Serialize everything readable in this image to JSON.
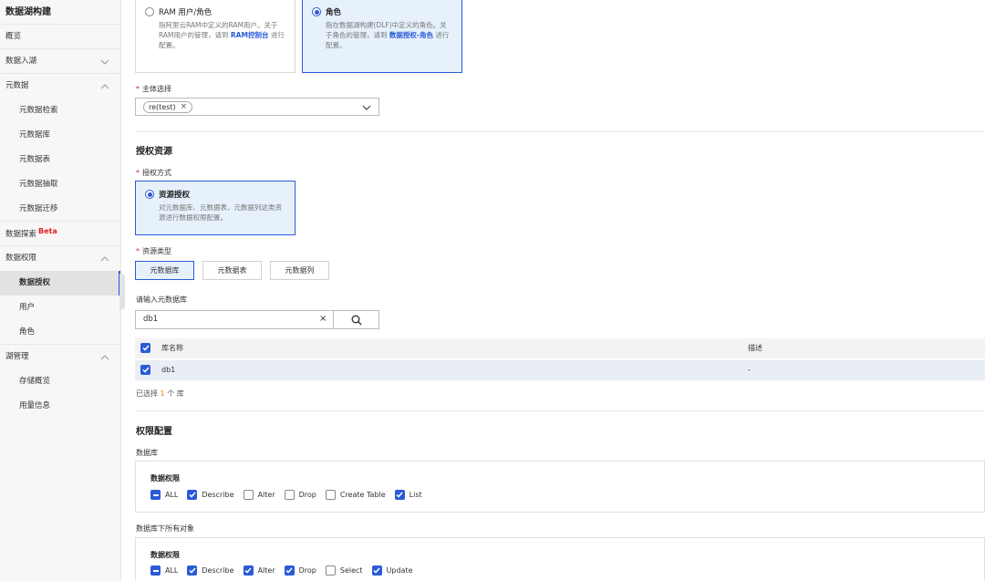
{
  "sidebar": {
    "title": "数据湖构建",
    "items": [
      {
        "label": "概览"
      },
      {
        "label": "数据入湖"
      },
      {
        "label": "元数据"
      },
      {
        "label": "元数据检索"
      },
      {
        "label": "元数据库"
      },
      {
        "label": "元数据表"
      },
      {
        "label": "元数据抽取"
      },
      {
        "label": "元数据迁移"
      },
      {
        "label": "数据探索",
        "badge": "Beta"
      },
      {
        "label": "数据权限"
      },
      {
        "label": "数据授权"
      },
      {
        "label": "用户"
      },
      {
        "label": "角色"
      },
      {
        "label": "湖管理"
      },
      {
        "label": "存储概览"
      },
      {
        "label": "用量信息"
      }
    ]
  },
  "principal_type": {
    "ram": {
      "title": "RAM 用户/角色",
      "desc_prefix": "指阿里云RAM中定义的RAM用户。关于RAM用户的管理，请到",
      "link": "RAM控制台",
      "desc_suffix": "进行配置。"
    },
    "role": {
      "title": "角色",
      "desc_prefix": "指在数据湖构建(DLF)中定义的角色。关于角色的管理，请到",
      "link": "数据授权-角色",
      "desc_suffix": "进行配置。"
    }
  },
  "principal_select": {
    "label": "主体选择",
    "tag": "re(test)"
  },
  "auth_resource": {
    "title": "授权资源",
    "method_label": "授权方式",
    "method": {
      "title": "资源授权",
      "desc": "对元数据库、元数据表、元数据列这类资源进行数据权限配置。"
    },
    "type_label": "资源类型",
    "types": [
      "元数据库",
      "元数据表",
      "元数据列"
    ],
    "search_label": "请输入元数据库",
    "search_value": "db1",
    "clear": "×"
  },
  "table": {
    "headers": [
      "库名称",
      "描述"
    ],
    "rows": [
      {
        "name": "db1",
        "desc": "-"
      }
    ],
    "selected_prefix": "已选择",
    "selected_count": "1",
    "selected_unit": "个",
    "selected_suffix": "库"
  },
  "perm_config": {
    "title": "权限配置",
    "db_label": "数据库",
    "db_box_title": "数据权限",
    "db_opts": [
      {
        "label": "ALL",
        "state": "ind"
      },
      {
        "label": "Describe",
        "state": "on"
      },
      {
        "label": "Alter",
        "state": "off"
      },
      {
        "label": "Drop",
        "state": "off"
      },
      {
        "label": "Create Table",
        "state": "off"
      },
      {
        "label": "List",
        "state": "on"
      }
    ],
    "obj_label": "数据库下所有对象",
    "obj_box_title": "数据权限",
    "obj_opts": [
      {
        "label": "ALL",
        "state": "ind"
      },
      {
        "label": "Describe",
        "state": "on"
      },
      {
        "label": "Alter",
        "state": "on"
      },
      {
        "label": "Drop",
        "state": "on"
      },
      {
        "label": "Select",
        "state": "off"
      },
      {
        "label": "Update",
        "state": "on"
      }
    ]
  },
  "colors": {
    "accent": "#2a5bd7",
    "selected_bg": "#e6f1fb",
    "required": "#e02020"
  }
}
